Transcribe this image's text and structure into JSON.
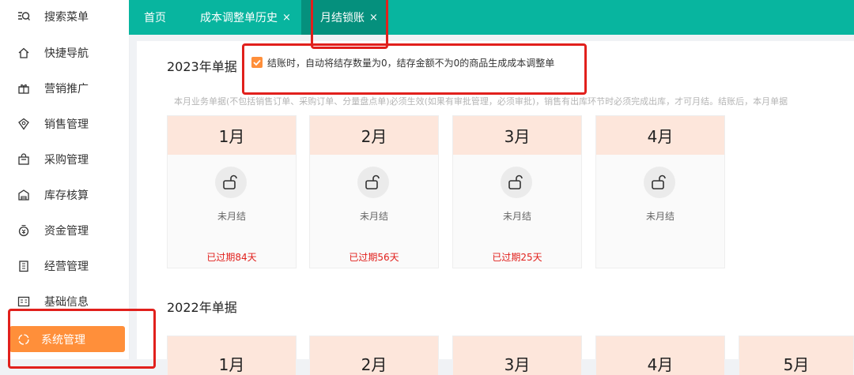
{
  "sidebar": {
    "items": [
      {
        "label": "搜索菜单",
        "icon": "search-menu-icon"
      },
      {
        "label": "快捷导航",
        "icon": "home-icon"
      },
      {
        "label": "营销推广",
        "icon": "gift-icon"
      },
      {
        "label": "销售管理",
        "icon": "sales-icon"
      },
      {
        "label": "采购管理",
        "icon": "bag-icon"
      },
      {
        "label": "库存核算",
        "icon": "warehouse-icon"
      },
      {
        "label": "资金管理",
        "icon": "money-icon"
      },
      {
        "label": "经营管理",
        "icon": "clipboard-icon"
      },
      {
        "label": "基础信息",
        "icon": "info-card-icon"
      },
      {
        "label": "系统管理",
        "icon": "settings-icon",
        "active": true
      }
    ]
  },
  "tabs": [
    {
      "label": "首页"
    },
    {
      "label": "成本调整单历史",
      "close": "×"
    },
    {
      "label": "月结锁账",
      "close": "×",
      "active": true
    }
  ],
  "main": {
    "year_2023": "2023年单据",
    "year_2022": "2022年单据",
    "auto_adjust_label": "结账时，自动将结存数量为0，结存金额不为0的商品生成成本调整单",
    "notice": "本月业务单据(不包括销售订单、采购订单、分量盘点单)必须生效(如果有审批管理，必须审批)，销售有出库环节时必须完成出库，才可月结。结账后，本月单据",
    "months_2023": [
      {
        "month": "1月",
        "status": "未月结",
        "expired": "已过期84天"
      },
      {
        "month": "2月",
        "status": "未月结",
        "expired": "已过期56天"
      },
      {
        "month": "3月",
        "status": "未月结",
        "expired": "已过期25天"
      },
      {
        "month": "4月",
        "status": "未月结",
        "expired": ""
      }
    ],
    "months_2022": [
      {
        "month": "1月"
      },
      {
        "month": "2月"
      },
      {
        "month": "3月"
      },
      {
        "month": "4月"
      },
      {
        "month": "5月"
      }
    ]
  },
  "colors": {
    "topbar": "#08b59f",
    "active_tab": "#05907d",
    "accent": "#ff8f3a",
    "highlight": "#e1201c",
    "card_header": "#fde6db",
    "expired": "#e1201c"
  }
}
